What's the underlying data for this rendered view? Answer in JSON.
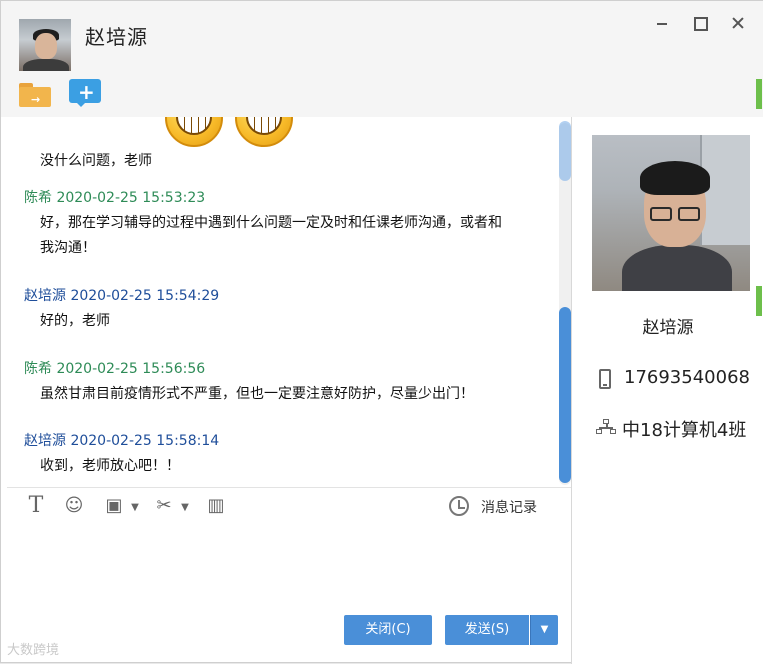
{
  "window": {
    "title": "赵培源"
  },
  "toolbar_top": {
    "icons": [
      "folder-transfer-icon",
      "add-chat-icon"
    ]
  },
  "messages": [
    {
      "sender": "",
      "timestamp": "",
      "text": "没什么问题，老师",
      "role": "student"
    },
    {
      "sender": "陈希",
      "timestamp": "2020-02-25 15:53:23",
      "lines": [
        "好，那在学习辅导的过程中遇到什么问题一定及时和任课老师沟通，或者和",
        "我沟通！"
      ],
      "role": "teacher"
    },
    {
      "sender": "赵培源",
      "timestamp": "2020-02-25 15:54:29",
      "text": "好的，老师",
      "role": "student"
    },
    {
      "sender": "陈希",
      "timestamp": "2020-02-25 15:56:56",
      "text": "虽然甘肃目前疫情形式不严重，但也一定要注意好防护，尽量少出门！",
      "role": "teacher"
    },
    {
      "sender": "赵培源",
      "timestamp": "2020-02-25 15:58:14",
      "text": "收到，老师放心吧！！",
      "role": "student"
    }
  ],
  "input_toolbar": {
    "font_glyph": "T",
    "history_label": "消息记录"
  },
  "buttons": {
    "close_label": "关闭(C)",
    "send_label": "发送(S)",
    "send_caret": "▼"
  },
  "profile": {
    "name": "赵培源",
    "phone": "17693540068",
    "class": "中18计算机4班"
  },
  "watermark": "大数跨境",
  "colors": {
    "accent": "#4a8fd8",
    "teacher_name": "#2e8b57",
    "student_name": "#1f4e9a"
  }
}
